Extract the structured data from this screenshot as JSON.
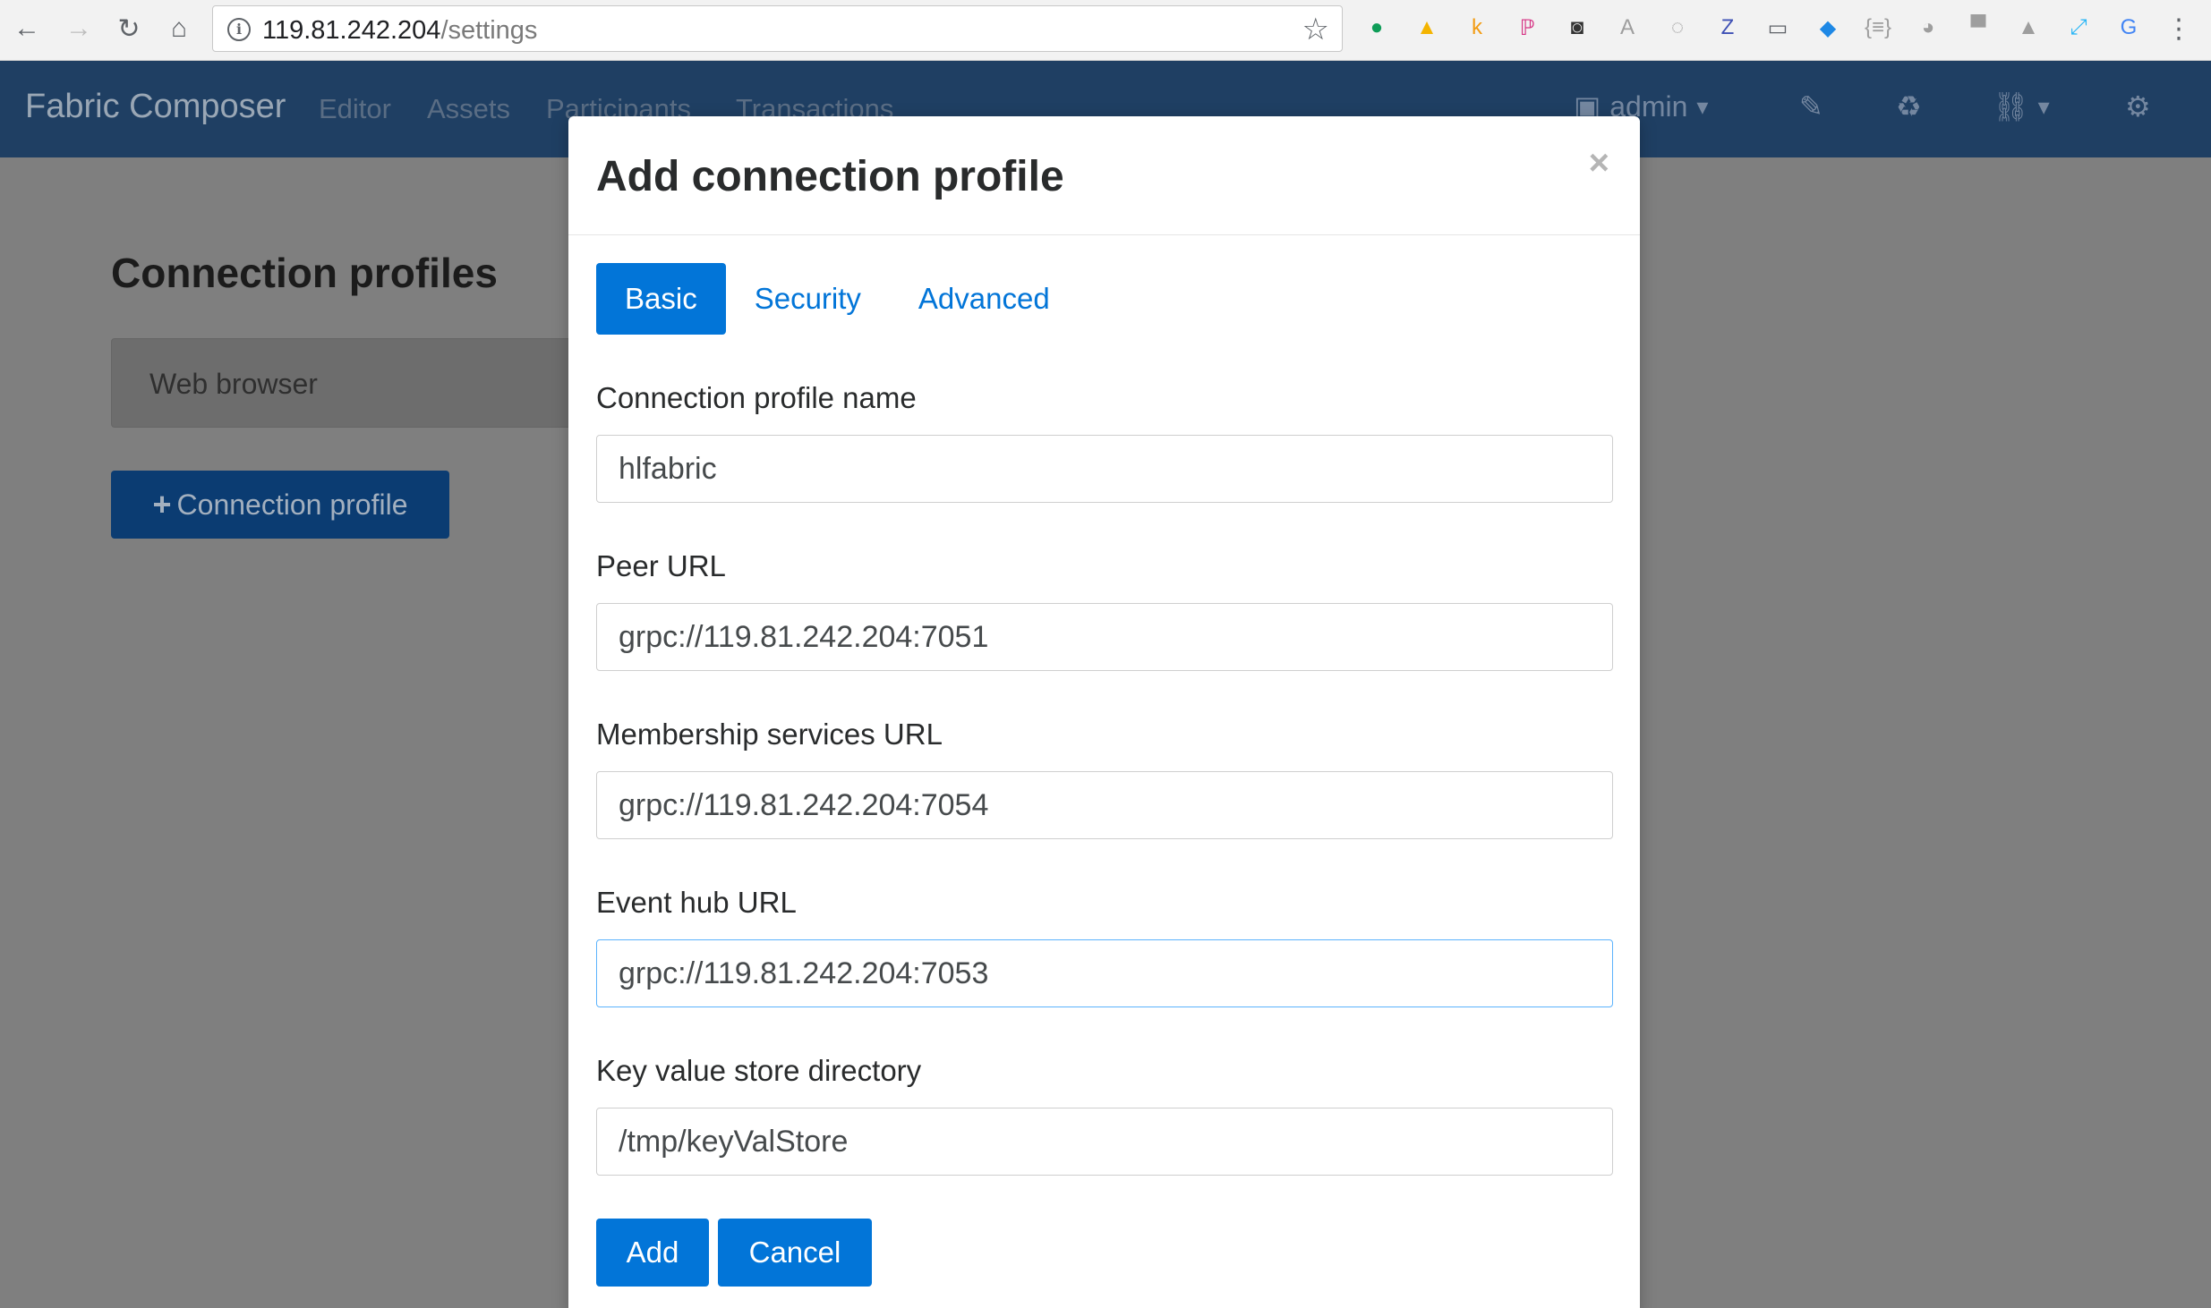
{
  "browser": {
    "url_host": "119.81.242.204",
    "url_path": "/settings",
    "back_icon": "←",
    "forward_icon": "→",
    "reload_icon": "↻",
    "home_icon": "⌂",
    "star_icon": "☆",
    "info_icon": "i",
    "menu_icon": "⋮",
    "extensions": [
      {
        "name": "hangouts-extension-icon",
        "glyph": "●",
        "color": "#0f9d58"
      },
      {
        "name": "drive-extension-icon",
        "glyph": "▲",
        "color": "#f4b400"
      },
      {
        "name": "k-extension-icon",
        "glyph": "k",
        "color": "#f39c12"
      },
      {
        "name": "p-extension-icon",
        "glyph": "ℙ",
        "color": "#d63384"
      },
      {
        "name": "mask-extension-icon",
        "glyph": "◙",
        "color": "#333333"
      },
      {
        "name": "a-extension-icon",
        "glyph": "A",
        "color": "#9e9e9e"
      },
      {
        "name": "json-extension-icon",
        "glyph": "◌",
        "color": "#9e9e9e"
      },
      {
        "name": "z-extension-icon",
        "glyph": "Z",
        "color": "#3f51b5"
      },
      {
        "name": "cast-icon",
        "glyph": "▭",
        "color": "#5f6368"
      },
      {
        "name": "diamond-extension-icon",
        "glyph": "◆",
        "color": "#1e88e5"
      },
      {
        "name": "braces-extension-icon",
        "glyph": "{≡}",
        "color": "#9e9e9e"
      },
      {
        "name": "chat-extension-icon",
        "glyph": "◕",
        "color": "#9e9e9e"
      },
      {
        "name": "monitor-extension-icon",
        "glyph": "▀",
        "color": "#9e9e9e"
      },
      {
        "name": "drive-gray-extension-icon",
        "glyph": "▲",
        "color": "#9e9e9e"
      },
      {
        "name": "link-extension-icon",
        "glyph": "⤢",
        "color": "#29b6f6"
      },
      {
        "name": "translate-extension-icon",
        "glyph": "G",
        "color": "#4285f4"
      }
    ]
  },
  "navbar": {
    "brand": "Fabric Composer",
    "links": [
      "Editor",
      "Assets",
      "Participants",
      "Transactions"
    ],
    "user_label": "admin",
    "id_card_icon": "▣",
    "dropdown_icon": "▾",
    "edit_icon": "✎",
    "recycle_icon": "♻",
    "network_icon": "⛓",
    "settings_icon": "⚙"
  },
  "page": {
    "title": "Connection profiles",
    "profiles": [
      "Web browser"
    ],
    "add_button_plus": "+",
    "add_button_label": "Connection profile"
  },
  "modal": {
    "title": "Add connection profile",
    "close": "×",
    "tabs": [
      "Basic",
      "Security",
      "Advanced"
    ],
    "active_tab": "Basic",
    "fields": {
      "name": {
        "label": "Connection profile name",
        "value": "hlfabric"
      },
      "peer_url": {
        "label": "Peer URL",
        "value": "grpc://119.81.242.204:7051"
      },
      "membership_url": {
        "label": "Membership services URL",
        "value": "grpc://119.81.242.204:7054"
      },
      "eventhub_url": {
        "label": "Event hub URL",
        "value": "grpc://119.81.242.204:7053"
      },
      "keyvalstore": {
        "label": "Key value store directory",
        "value": "/tmp/keyValStore"
      }
    },
    "add_label": "Add",
    "cancel_label": "Cancel"
  }
}
